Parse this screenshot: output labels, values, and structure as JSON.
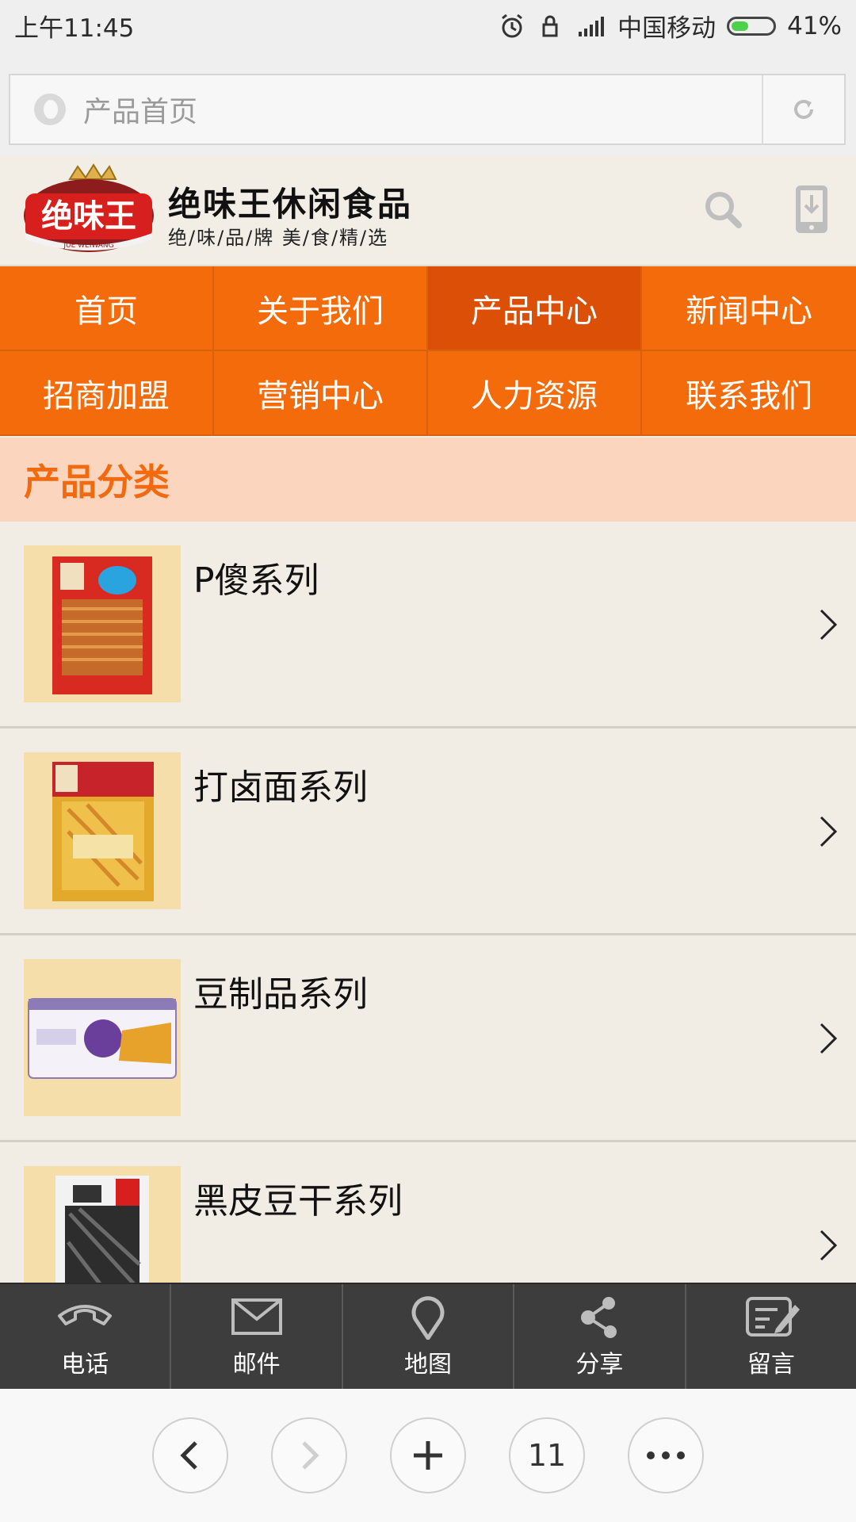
{
  "status_bar": {
    "time": "上午11:45",
    "carrier": "中国移动",
    "battery": "41%",
    "battery_level": 0.41,
    "icons": [
      "alarm-icon",
      "lock-icon",
      "signal-icon",
      "battery-icon"
    ]
  },
  "address_bar": {
    "title": "产品首页",
    "reload_icon": "reload-icon"
  },
  "header": {
    "logo_text": "绝味王",
    "logo_subtext": "JUE WEIWANG",
    "site_name": "绝味王休闲食品",
    "slogan": "绝/味/品/牌  美/食/精/选"
  },
  "nav": {
    "items": [
      {
        "label": "首页",
        "active": false
      },
      {
        "label": "关于我们",
        "active": false
      },
      {
        "label": "产品中心",
        "active": true
      },
      {
        "label": "新闻中心",
        "active": false
      },
      {
        "label": "招商加盟",
        "active": false
      },
      {
        "label": "营销中心",
        "active": false
      },
      {
        "label": "人力资源",
        "active": false
      },
      {
        "label": "联系我们",
        "active": false
      }
    ]
  },
  "category": {
    "title": "产品分类",
    "items": [
      {
        "name": "P傻系列"
      },
      {
        "name": "打卤面系列"
      },
      {
        "name": "豆制品系列"
      },
      {
        "name": "黑皮豆干系列"
      }
    ]
  },
  "toolbar": {
    "items": [
      {
        "label": "电话",
        "icon": "phone-icon"
      },
      {
        "label": "邮件",
        "icon": "mail-icon"
      },
      {
        "label": "地图",
        "icon": "map-pin-icon"
      },
      {
        "label": "分享",
        "icon": "share-icon"
      },
      {
        "label": "留言",
        "icon": "message-icon"
      }
    ]
  },
  "browser_nav": {
    "tab_count": "11"
  },
  "colors": {
    "nav_bg": "#f36b0b",
    "nav_active": "#dc4f06",
    "category_title": "#f26a10",
    "category_bg": "#fbd5be",
    "toolbar_bg": "#3d3d3d"
  }
}
